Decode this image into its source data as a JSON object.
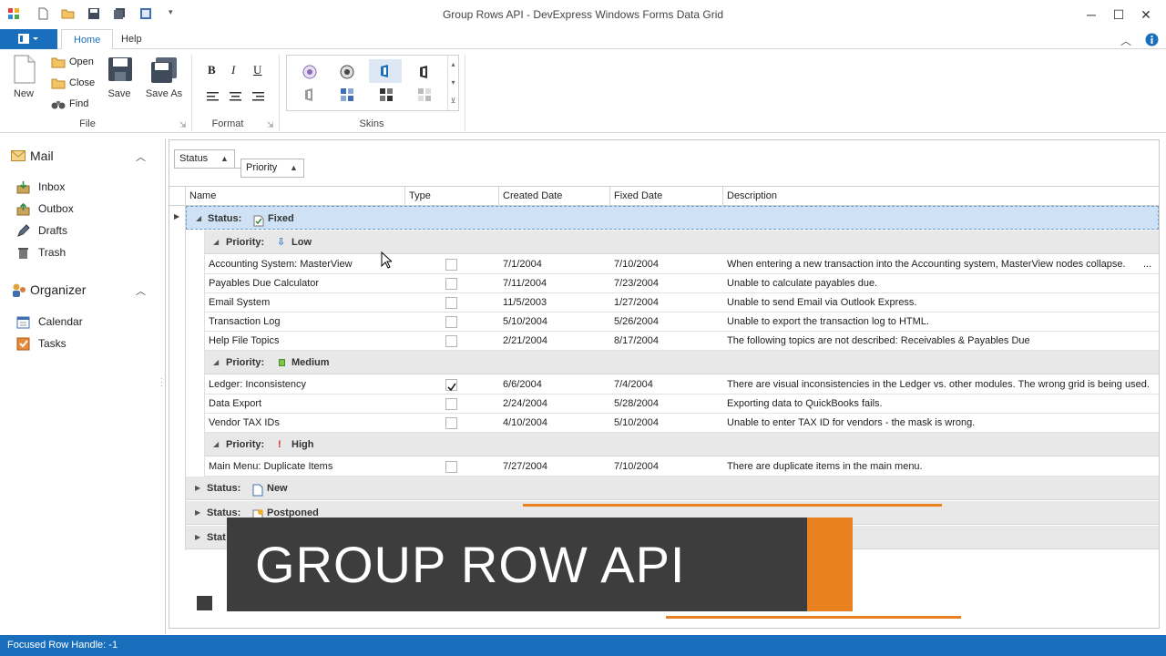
{
  "window": {
    "title": "Group Rows API - DevExpress Windows Forms Data Grid"
  },
  "ribbon": {
    "tabs": [
      "Home",
      "Help"
    ],
    "file": {
      "new": "New",
      "open": "Open",
      "close": "Close",
      "find": "Find",
      "save": "Save",
      "save_as": "Save As",
      "group_label": "File"
    },
    "format": {
      "bold": "B",
      "italic": "I",
      "underline": "U",
      "group_label": "Format"
    },
    "skins": {
      "group_label": "Skins"
    }
  },
  "nav": {
    "mail": {
      "title": "Mail",
      "items": [
        "Inbox",
        "Outbox",
        "Drafts",
        "Trash"
      ]
    },
    "organizer": {
      "title": "Organizer",
      "items": [
        "Calendar",
        "Tasks"
      ]
    }
  },
  "grid": {
    "group_panel": [
      "Status",
      "Priority"
    ],
    "columns": [
      "Name",
      "Type",
      "Created Date",
      "Fixed Date",
      "Description"
    ],
    "status_label": "Status:",
    "priority_label": "Priority:",
    "groups": {
      "fixed": "Fixed",
      "low": "Low",
      "medium": "Medium",
      "high": "High",
      "new": "New",
      "postponed": "Postponed",
      "partial": "Stat"
    },
    "rows_low": [
      {
        "name": "Accounting System: MasterView",
        "checked": false,
        "created": "7/1/2004",
        "fixed": "7/10/2004",
        "desc": "When entering a new transaction into the Accounting system, MasterView nodes collapse."
      },
      {
        "name": "Payables Due Calculator",
        "checked": false,
        "created": "7/11/2004",
        "fixed": "7/23/2004",
        "desc": "Unable to calculate payables due."
      },
      {
        "name": "Email System",
        "checked": false,
        "created": "11/5/2003",
        "fixed": "1/27/2004",
        "desc": "Unable to send Email via Outlook Express."
      },
      {
        "name": "Transaction Log",
        "checked": false,
        "created": "5/10/2004",
        "fixed": "5/26/2004",
        "desc": "Unable to export the transaction log to HTML."
      },
      {
        "name": "Help File Topics",
        "checked": false,
        "created": "2/21/2004",
        "fixed": "8/17/2004",
        "desc": "The following topics are not described: Receivables & Payables Due"
      }
    ],
    "rows_medium": [
      {
        "name": "Ledger: Inconsistency",
        "checked": true,
        "created": "6/6/2004",
        "fixed": "7/4/2004",
        "desc": "There are visual inconsistencies in the Ledger vs. other modules. The wrong grid is being used."
      },
      {
        "name": "Data Export",
        "checked": false,
        "created": "2/24/2004",
        "fixed": "5/28/2004",
        "desc": "Exporting data to QuickBooks fails."
      },
      {
        "name": "Vendor TAX IDs",
        "checked": false,
        "created": "4/10/2004",
        "fixed": "5/10/2004",
        "desc": "Unable to enter TAX ID for vendors - the mask is wrong."
      }
    ],
    "rows_high": [
      {
        "name": "Main Menu: Duplicate Items",
        "checked": false,
        "created": "7/27/2004",
        "fixed": "7/10/2004",
        "desc": "There are duplicate items in the main menu."
      }
    ],
    "ellipsis": "..."
  },
  "status_bar": {
    "text": "Focused Row Handle: -1"
  },
  "overlay": {
    "banner_text": "GROUP ROW API"
  },
  "colors": {
    "accent": "#1a6fbd",
    "orange": "#e98120",
    "banner": "#3d3d3d",
    "group_row": "#e8e8e8",
    "focused_group": "#cfe2f5"
  }
}
